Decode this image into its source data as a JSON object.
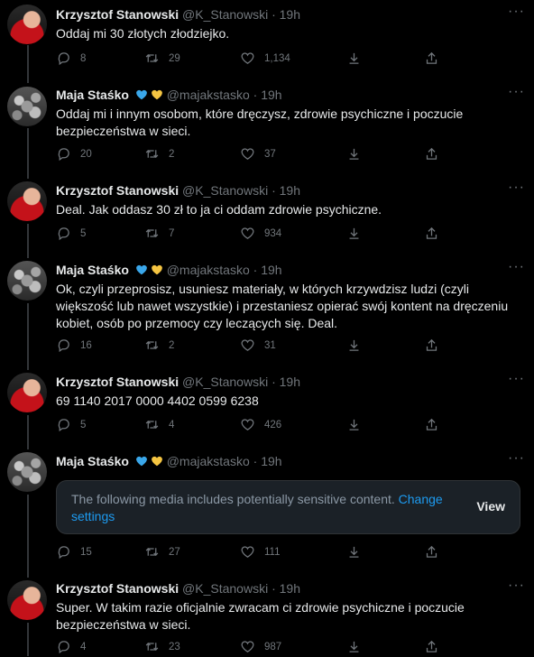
{
  "colors": {
    "background": "#000000",
    "text": "#e7e9ea",
    "muted": "#71767b",
    "link": "#1d9bf0"
  },
  "icons": {
    "reply": "reply-icon",
    "retweet": "retweet-icon",
    "like": "heart-icon",
    "share": "share-icon",
    "upload": "upload-icon",
    "more": "more-icon"
  },
  "tweets": [
    {
      "name": "Krzysztof Stanowski",
      "handle": "@K_Stanowski",
      "time": "· 19h",
      "text": "Oddaj mi 30 złotych złodziejko.",
      "replies": "8",
      "retweets": "29",
      "likes": "1,134"
    },
    {
      "name": "Maja Staśko",
      "handle": "@majakstasko",
      "time": "· 19h",
      "text": "Oddaj mi i innym osobom, które dręczysz, zdrowie psychiczne i poczucie bezpieczeństwa w sieci.",
      "replies": "20",
      "retweets": "2",
      "likes": "37"
    },
    {
      "name": "Krzysztof Stanowski",
      "handle": "@K_Stanowski",
      "time": "· 19h",
      "text": "Deal. Jak oddasz 30 zł to ja ci oddam zdrowie psychiczne.",
      "replies": "5",
      "retweets": "7",
      "likes": "934"
    },
    {
      "name": "Maja Staśko",
      "handle": "@majakstasko",
      "time": "· 19h",
      "text": "Ok, czyli przeprosisz, usuniesz materiały, w których krzywdzisz ludzi (czyli większość lub nawet wszystkie) i przestaniesz opierać swój kontent na dręczeniu kobiet, osób po przemocy czy leczących się. Deal.",
      "replies": "16",
      "retweets": "2",
      "likes": "31"
    },
    {
      "name": "Krzysztof Stanowski",
      "handle": "@K_Stanowski",
      "time": "· 19h",
      "text": "69 1140 2017 0000 4402 0599 6238",
      "replies": "5",
      "retweets": "4",
      "likes": "426"
    },
    {
      "name": "Maja Staśko",
      "handle": "@majakstasko",
      "time": "· 19h",
      "media_warning": "The following media includes potentially sensitive content.",
      "media_link": "Change settings",
      "view_label": "View",
      "replies": "15",
      "retweets": "27",
      "likes": "111"
    },
    {
      "name": "Krzysztof Stanowski",
      "handle": "@K_Stanowski",
      "time": "· 19h",
      "text": "Super. W takim razie oficjalnie zwracam ci zdrowie psychiczne i poczucie bezpieczeństwa w sieci.",
      "replies": "4",
      "retweets": "23",
      "likes": "987"
    }
  ]
}
